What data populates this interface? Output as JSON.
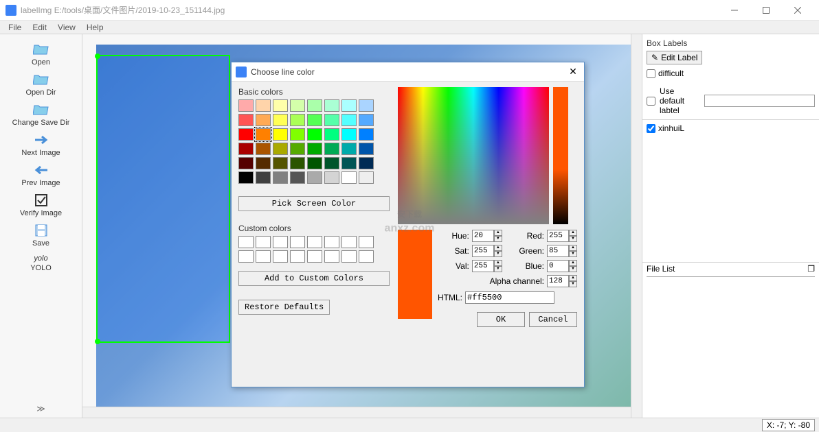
{
  "window": {
    "title": "labelImg E:/tools/桌面/文件图片/2019-10-23_151144.jpg"
  },
  "menu": {
    "file": "File",
    "edit": "Edit",
    "view": "View",
    "help": "Help"
  },
  "toolbar": {
    "open": "Open",
    "open_dir": "Open Dir",
    "change_save_dir": "Change Save Dir",
    "next_image": "Next Image",
    "prev_image": "Prev Image",
    "verify_image": "Verify Image",
    "save": "Save",
    "yolo_small": "yolo",
    "yolo": "YOLO"
  },
  "panels": {
    "box_labels_title": "Box Labels",
    "edit_label": "Edit Label",
    "difficult": "difficult",
    "use_default_label": "Use default labtel",
    "default_label_value": "",
    "label_item": "xinhuiL",
    "file_list_title": "File List"
  },
  "status": {
    "coords": "X: -7; Y: -80"
  },
  "dialog": {
    "title": "Choose line color",
    "basic_colors": "Basic colors",
    "pick_screen_color": "Pick Screen Color",
    "custom_colors": "Custom colors",
    "add_custom": "Add to Custom Colors",
    "restore": "Restore Defaults",
    "hue_label": "Hue:",
    "hue": "20",
    "sat_label": "Sat:",
    "sat": "255",
    "val_label": "Val:",
    "val": "255",
    "red_label": "Red:",
    "red": "255",
    "green_label": "Green:",
    "green": "85",
    "blue_label": "Blue:",
    "blue": "0",
    "alpha_label": "Alpha channel:",
    "alpha": "128",
    "html_label": "HTML:",
    "html": "#ff5500",
    "ok": "OK",
    "cancel": "Cancel",
    "basic_palette": [
      "#ffaaaa",
      "#ffd4aa",
      "#ffffaa",
      "#d4ffaa",
      "#aaffaa",
      "#aaffd4",
      "#aaffff",
      "#aad4ff",
      "#ff5555",
      "#ffaa55",
      "#ffff55",
      "#aaff55",
      "#55ff55",
      "#55ffaa",
      "#55ffff",
      "#55aaff",
      "#ff0000",
      "#ff8000",
      "#ffff00",
      "#80ff00",
      "#00ff00",
      "#00ff80",
      "#00ffff",
      "#0080ff",
      "#aa0000",
      "#aa5500",
      "#aaaa00",
      "#55aa00",
      "#00aa00",
      "#00aa55",
      "#00aaaa",
      "#0055aa",
      "#550000",
      "#552b00",
      "#555500",
      "#2b5500",
      "#005500",
      "#00552b",
      "#005555",
      "#002b55",
      "#000000",
      "#404040",
      "#808080",
      "#555555",
      "#aaaaaa",
      "#d4d4d4",
      "#ffffff",
      "#eeeeee"
    ]
  },
  "watermark": {
    "main": "安下载",
    "sub": "anxz.com"
  }
}
